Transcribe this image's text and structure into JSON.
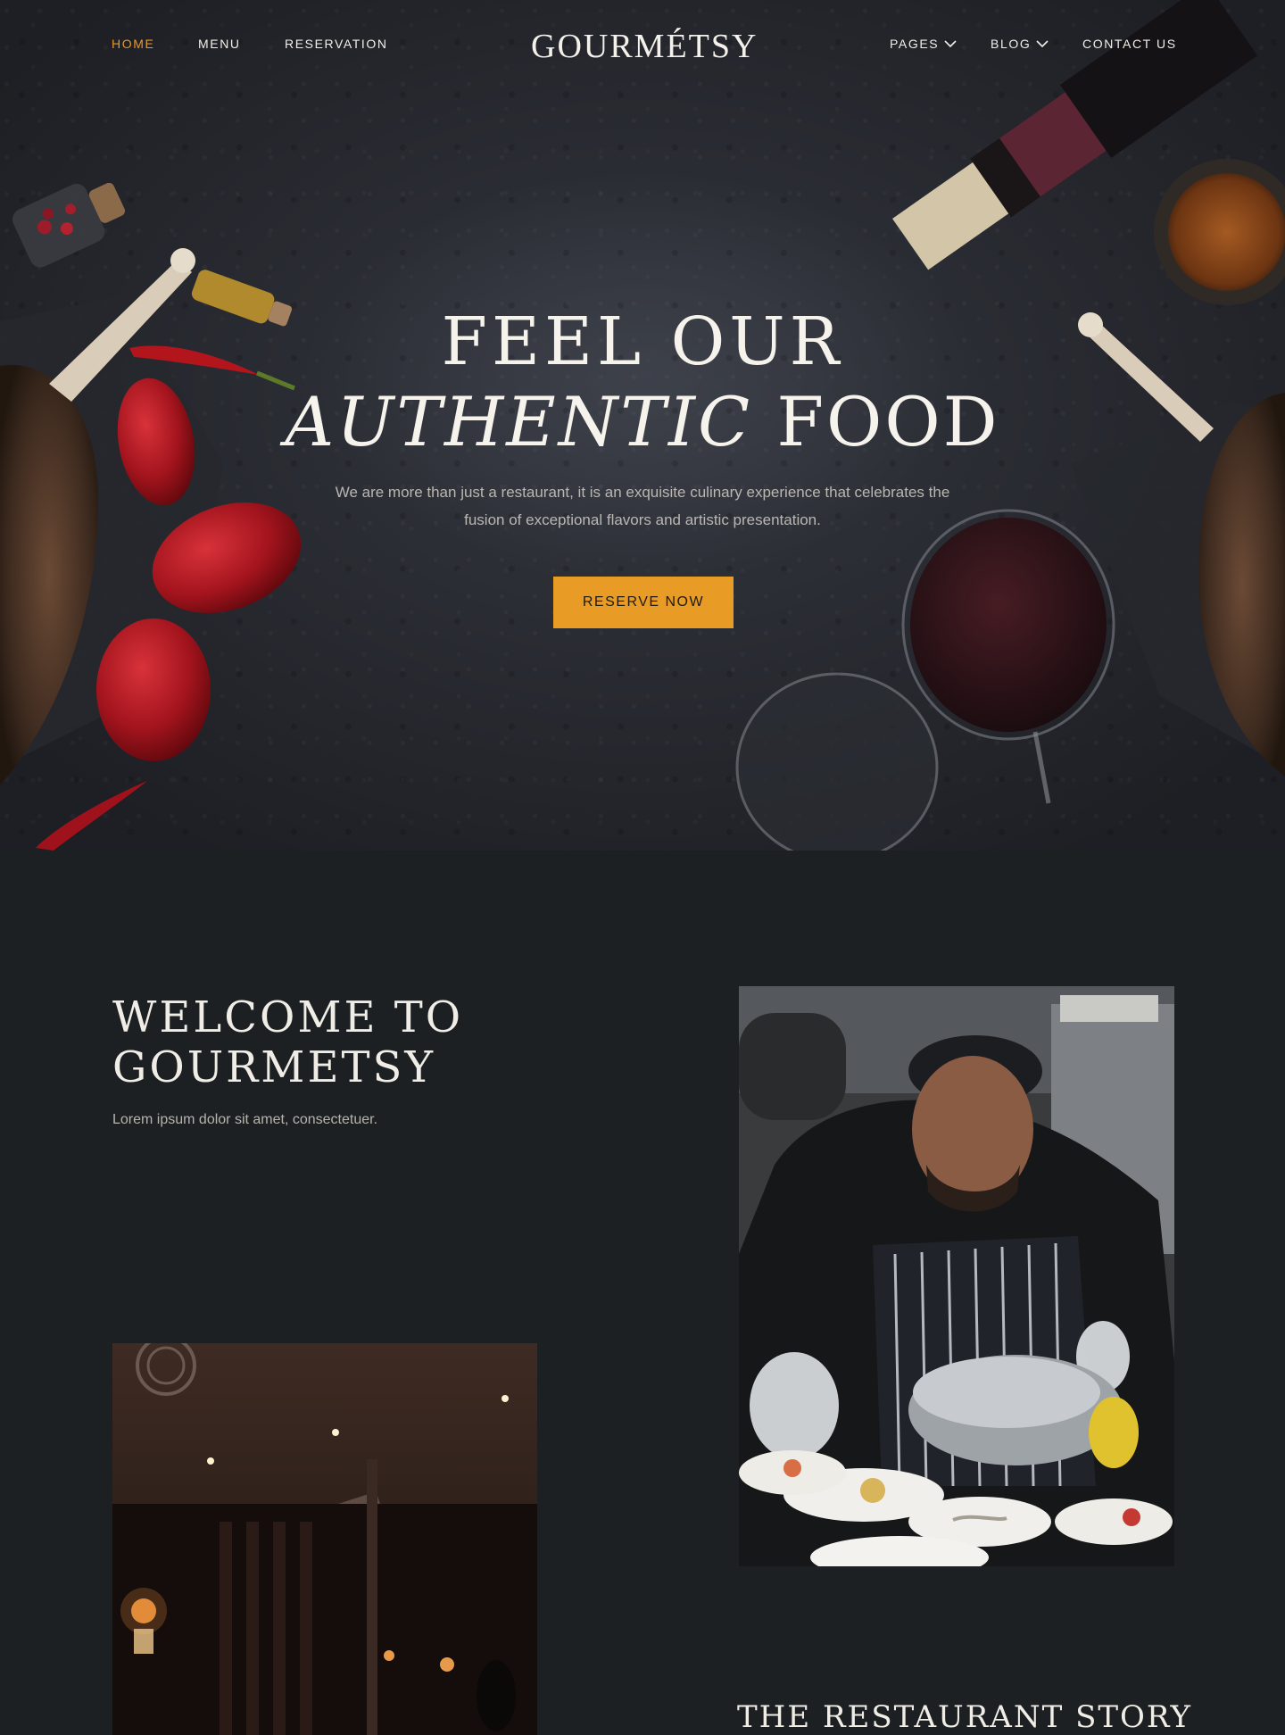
{
  "brand": {
    "logo": "GOURMÉTSY",
    "accent": "#e89b25"
  },
  "nav": {
    "left": [
      {
        "label": "HOME",
        "active": true
      },
      {
        "label": "MENU"
      },
      {
        "label": "RESERVATION"
      }
    ],
    "right": [
      {
        "label": "PAGES",
        "dropdown": true
      },
      {
        "label": "BLOG",
        "dropdown": true
      },
      {
        "label": "CONTACT US"
      }
    ]
  },
  "hero": {
    "title_line1": "FEEL OUR",
    "title_line2_italic": "AUTHENTIC",
    "title_line2_rest": " FOOD",
    "subtitle": "We are more than just a restaurant, it is an exquisite culinary experience that celebrates the fusion of exceptional flavors and artistic presentation.",
    "cta": "RESERVE NOW"
  },
  "welcome": {
    "title_line1": "WELCOME TO",
    "title_line2": "GOURMETSY",
    "subtitle": "Lorem ipsum dolor sit amet, consectetuer."
  },
  "story": {
    "title": "THE RESTAURANT STORY"
  },
  "icons": [
    "chevron-down-icon"
  ]
}
